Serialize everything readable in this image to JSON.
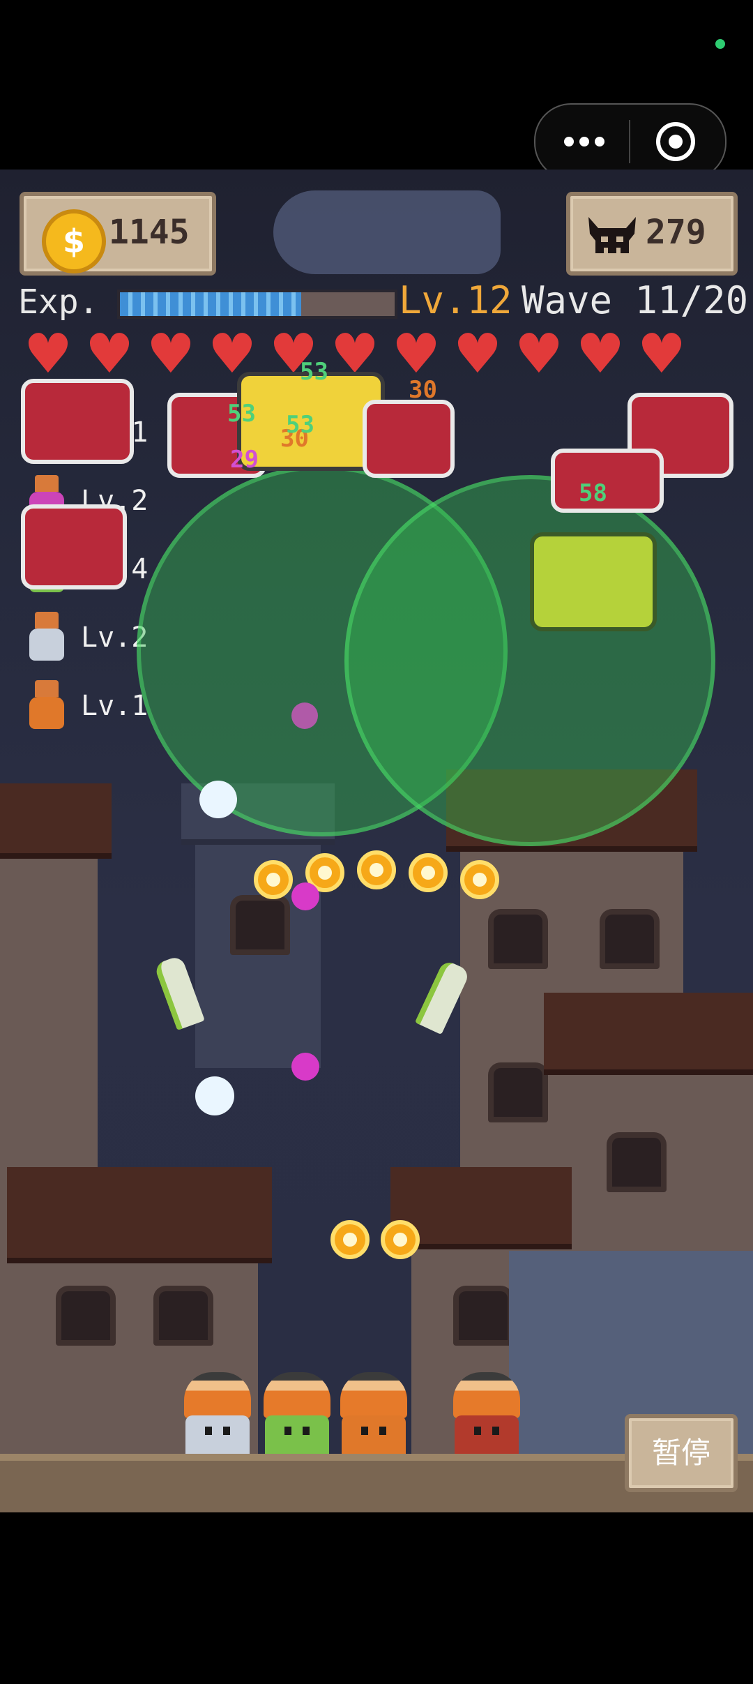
{
  "hud": {
    "coins": "1145",
    "enemies_left": "279",
    "exp_label": "Exp.",
    "exp_progress": 0.66,
    "level": "Lv.12",
    "wave": "Wave 11/20",
    "hearts": 11
  },
  "team": [
    {
      "level": "Lv.1",
      "color": "#b23a2c"
    },
    {
      "level": "Lv.2",
      "color": "#cc44b8"
    },
    {
      "level": "Lv.4",
      "color": "#7ac14a"
    },
    {
      "level": "Lv.2",
      "color": "#c8d0dc"
    },
    {
      "level": "Lv.1",
      "color": "#e0782a"
    }
  ],
  "damage_numbers": [
    "29",
    "30",
    "30",
    "53",
    "53",
    "53",
    "58"
  ],
  "pause_label": "暂停",
  "icons": {
    "coin": "coin-icon",
    "skull": "demon-skull-icon",
    "more": "more-dots-icon",
    "close": "target-close-icon",
    "heart": "heart-icon"
  },
  "colors": {
    "zone": "#34be50",
    "bullet": "#f6a818",
    "exp": "#3f8fd6",
    "level": "#f0a83a"
  }
}
